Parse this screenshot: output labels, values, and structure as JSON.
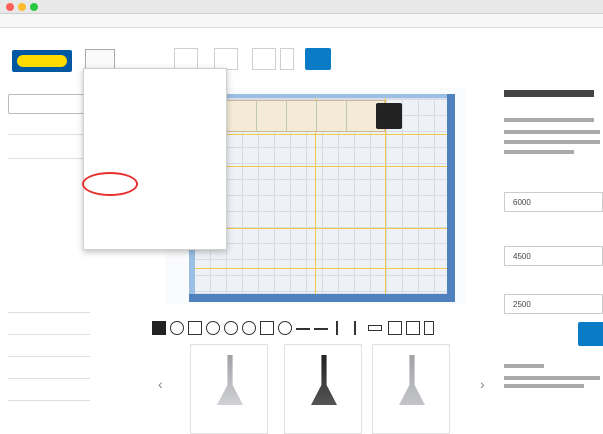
{
  "toolbar": {
    "file_menu": "",
    "edit_menu": ""
  },
  "sidebar": {
    "search_placeholder": "",
    "section_kitchen": "",
    "subitems": []
  },
  "canvas": {
    "width_dim": "",
    "depth_dim": ""
  },
  "file_menu": {
    "items": []
  },
  "products": {
    "items": [
      {
        "name": ""
      },
      {
        "name": ""
      },
      {
        "name": ""
      }
    ]
  },
  "right_panel": {
    "title": "",
    "width_label": "",
    "width_value": "6000",
    "depth_label": "",
    "depth_value": "4500",
    "ceiling_label": "",
    "ceiling_value": "2500"
  },
  "colors": {
    "ikea_blue": "#0058a3",
    "ikea_yellow": "#ffdb00",
    "accent": "#0a7cc7",
    "wall": "#4f81bd",
    "highlight": "#e53030"
  }
}
